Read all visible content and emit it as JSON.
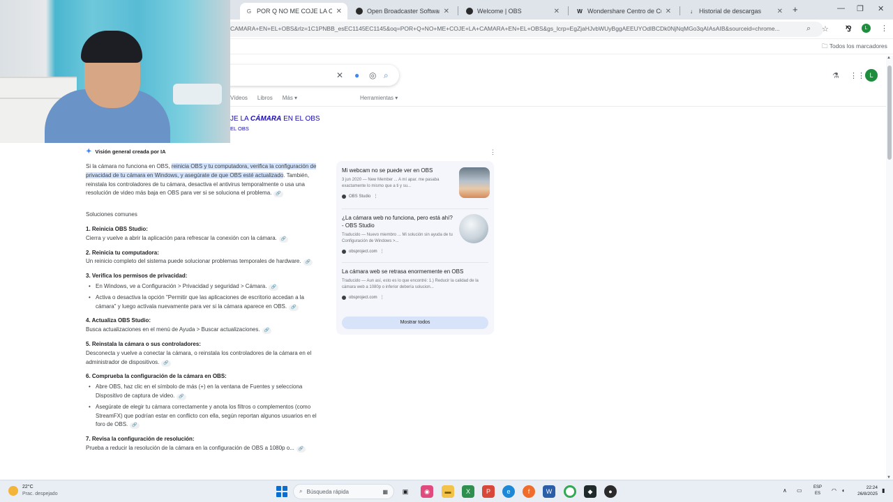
{
  "browser": {
    "tabs": [
      {
        "label": "POR Q NO ME COJE LA CAMA",
        "active": true,
        "favicon": "google-icon"
      },
      {
        "label": "Open Broadcaster Software | O",
        "active": false,
        "favicon": "obs-icon"
      },
      {
        "label": "Welcome | OBS",
        "active": false,
        "favicon": "obs-icon"
      },
      {
        "label": "Wondershare Centro de Cuenta",
        "active": false,
        "favicon": "wondershare-icon"
      },
      {
        "label": "Historial de descargas",
        "active": false,
        "favicon": "download-icon"
      }
    ],
    "url": "CAMARA+EN+EL+OBS&rlz=1C1PNBB_esEC1145EC1145&oq=POR+Q+NO+ME+COJE+LA+CAMARA+EN+EL+OBS&gs_lcrp=EgZjaHJvbWUyBggAEEUYOdIBCDk0NjNqMGo3qAIAsAIB&sourceid=chrome...",
    "bookmarks_all": "Todos los marcadores"
  },
  "google": {
    "filters": [
      "Vídeos",
      "Libros",
      "Más"
    ],
    "tools": "Herramientas",
    "query_title_prefix": "JE LA ",
    "query_title_bold": "CÁMARA",
    "query_title_suffix": " EN EL OBS",
    "query_subtitle": "EL OBS",
    "avatar_letter": "L"
  },
  "ai_overview": {
    "header": "Visión general creada por IA",
    "intro_plain": "Si la cámara no funciona en OBS, ",
    "intro_highlight": "reinicia OBS y tu computadora, verifica la configuración de privacidad de tu cámara en Windows, y asegúrate de que OBS esté actualizado",
    "intro_rest": ". También, reinstala los controladores de tu cámara, desactiva el antivirus temporalmente o usa una resolución de video más baja en OBS para ver si se soluciona el problema.",
    "solutions_heading": "Soluciones comunes",
    "sections": [
      {
        "title": "1. Reinicia OBS Studio:",
        "text": "Cierra y vuelve a abrir la aplicación para refrescar la conexión con la cámara.",
        "bullets": []
      },
      {
        "title": "2. Reinicia tu computadora:",
        "text": "Un reinicio completo del sistema puede solucionar problemas temporales de hardware.",
        "bullets": []
      },
      {
        "title": "3. Verifica los permisos de privacidad:",
        "text": "",
        "bullets": [
          "En Windows, ve a Configuración > Privacidad y seguridad > Cámara.",
          "Activa o desactiva la opción \"Permitir que las aplicaciones de escritorio accedan a la cámara\" y luego actívala nuevamente para ver si la cámara aparece en OBS."
        ]
      },
      {
        "title": "4. Actualiza OBS Studio:",
        "text": "Busca actualizaciones en el menú de Ayuda > Buscar actualizaciones.",
        "bullets": []
      },
      {
        "title": "5. Reinstala la cámara o sus controladores:",
        "text": "Desconecta y vuelve a conectar la cámara, o reinstala los controladores de la cámara en el administrador de dispositivos.",
        "bullets": []
      },
      {
        "title": "6. Comprueba la configuración de la cámara en OBS:",
        "text": "",
        "bullets": [
          "Abre OBS, haz clic en el símbolo de más (+) en la ventana de Fuentes y selecciona Dispositivo de captura de video.",
          "Asegúrate de elegir tu cámara correctamente y anota los filtros o complementos (como StreamFX) que podrían estar en conflicto con ella, según reportan algunos usuarios en el foro de OBS."
        ]
      },
      {
        "title": "7. Revisa la configuración de resolución:",
        "text": "Prueba a reducir la resolución de la cámara en la configuración de OBS a 1080p o...",
        "bullets": []
      }
    ]
  },
  "sources": {
    "cards": [
      {
        "title": "Mi webcam no se puede ver en OBS",
        "snippet": "3 jun 2020 — New Member ... A mí apar. me pasaba exactamente lo mismo que a ti y su...",
        "site": "OBS Studio"
      },
      {
        "title": "¿La cámara web no funciona, pero está ahí? - OBS Studio",
        "snippet": "Traducido — Nuevo miembro ... Mi solución sin ayuda de tu Configuración de Windows >...",
        "site": "obsproject.com"
      },
      {
        "title": "La cámara web se retrasa enormemente en OBS",
        "snippet": "Traducido — Aun así, esto es lo que encontré: 1.) Reducir la calidad de la cámara web a 1080p o inferior debería solucion...",
        "site": "obsproject.com"
      }
    ],
    "show_all": "Mostrar todos"
  },
  "taskbar": {
    "weather_temp": "22°C",
    "weather_desc": "Prac. despejado",
    "search_placeholder": "Búsqueda rápida",
    "lang_top": "ESP",
    "lang_bottom": "ES",
    "time": "22:24",
    "date": "26/8/2025"
  }
}
